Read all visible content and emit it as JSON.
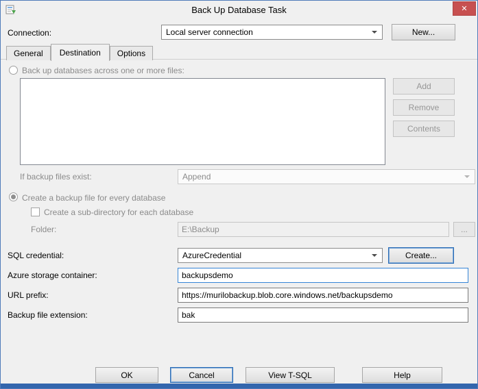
{
  "window": {
    "title": "Back Up Database Task",
    "close_glyph": "✕"
  },
  "colors": {
    "window_border": "#4f7bb9",
    "bottom_band": "#3366ad",
    "close_button": "#c75050",
    "focus_border": "#3584d6",
    "disabled_text": "#8b8b8b"
  },
  "connection": {
    "label": "Connection:",
    "value": "Local server connection",
    "new_button": "New..."
  },
  "tabs": {
    "general": "General",
    "destination": "Destination",
    "options": "Options"
  },
  "destination": {
    "across_radio_label": "Back up databases across one or more files:",
    "add_button": "Add",
    "remove_button": "Remove",
    "contents_button": "Contents",
    "if_exist_label": "If backup files exist:",
    "if_exist_value": "Append",
    "every_db_radio_label": "Create a backup file for every database",
    "subdir_checkbox_label": "Create a sub-directory for each database",
    "folder_label": "Folder:",
    "folder_value": "E:\\Backup",
    "browse_button": "...",
    "sql_credential_label": "SQL credential:",
    "sql_credential_value": "AzureCredential",
    "create_button": "Create...",
    "container_label": "Azure storage container:",
    "container_value": "backupsdemo",
    "url_prefix_label": "URL prefix:",
    "url_prefix_value": "https://murilobackup.blob.core.windows.net/backupsdemo",
    "extension_label": "Backup file extension:",
    "extension_value": "bak"
  },
  "footer": {
    "ok": "OK",
    "cancel": "Cancel",
    "view_tsql": "View T-SQL",
    "help": "Help"
  }
}
